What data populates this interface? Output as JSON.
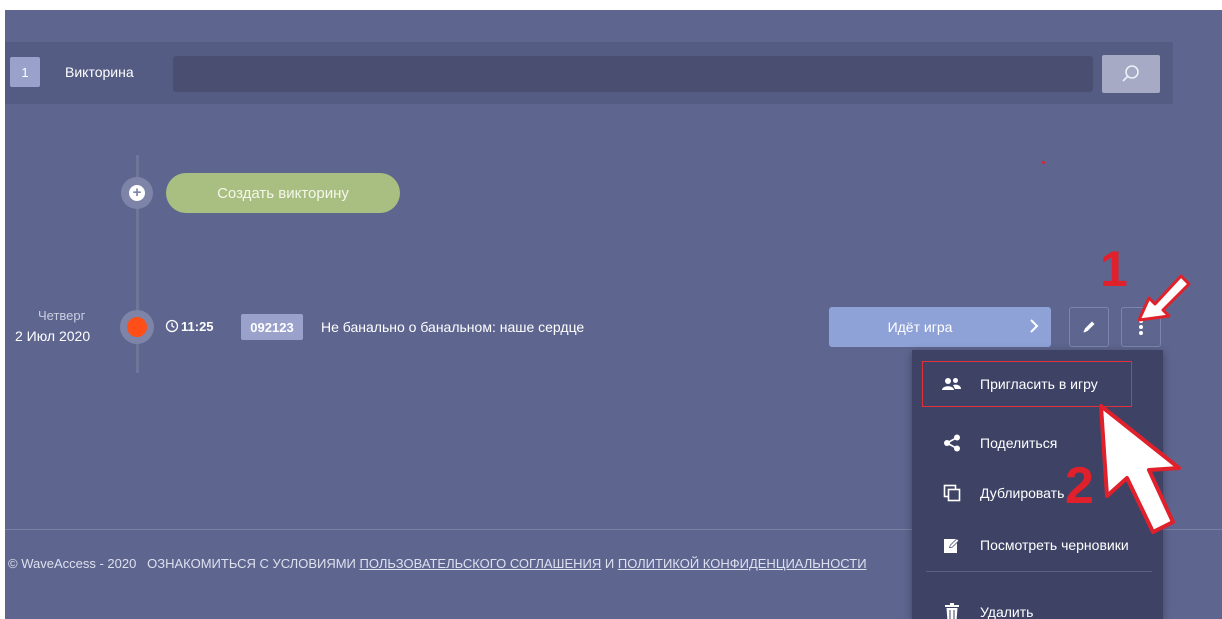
{
  "search": {
    "count": "1",
    "label": "Викторина",
    "value": ""
  },
  "timeline": {
    "create_label": "Создать викторину"
  },
  "event": {
    "day": "Четверг",
    "date": "2 Июл 2020",
    "time": "11:25",
    "code": "092123",
    "title": "Не банально о банальном: наше сердце",
    "status_label": "Идёт игра",
    "status_color": "#ff4e17"
  },
  "menu": {
    "items": [
      {
        "label": "Пригласить в игру",
        "icon": "invite-users-icon"
      },
      {
        "label": "Поделиться",
        "icon": "share-icon"
      },
      {
        "label": "Дублировать",
        "icon": "duplicate-icon"
      },
      {
        "label": "Посмотреть черновики",
        "icon": "drafts-icon"
      },
      {
        "label": "Удалить",
        "icon": "trash-icon"
      }
    ]
  },
  "footer": {
    "copyright": "© WaveAccess - 2020",
    "agree_text": "ОЗНАКОМИТЬСЯ С УСЛОВИЯМИ",
    "terms_link": "ПОЛЬЗОВАТЕЛЬСКОГО СОГЛАШЕНИЯ",
    "and": "И",
    "privacy_link": "ПОЛИТИКОЙ КОНФИДЕНЦИАЛЬНОСТИ"
  },
  "annotations": {
    "step1": "1",
    "step2": "2"
  },
  "colors": {
    "background": "#5e6690",
    "create_button": "#a9bf82",
    "status_button": "#8ea2d8",
    "annotation": "#e0202a"
  }
}
